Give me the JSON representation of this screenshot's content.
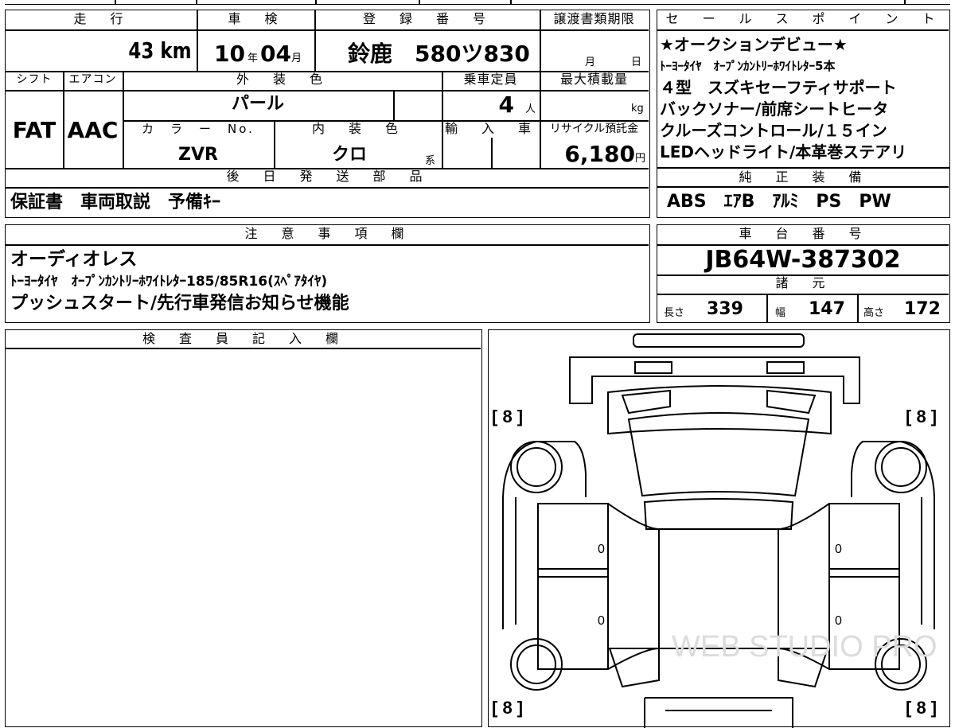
{
  "main": {
    "headers": {
      "mileage": "走　行",
      "inspection": "車　検",
      "reg": "登　録　番　号",
      "deadline": "譲渡書類期限",
      "shift": "シフト",
      "ac": "エアコン",
      "exterior": "外　装　色",
      "seats": "乗車定員",
      "maxload": "最大積載量",
      "colorno": "カ　ラ　ー　No.",
      "interior": "内　装　色",
      "import": "輸　入　車",
      "recycle": "リサイクル預託金"
    },
    "mileage": "43",
    "mileage_unit": "km",
    "inspection": {
      "year": "10",
      "year_unit": "年",
      "month": "04",
      "month_unit": "月"
    },
    "registration": "鈴鹿　580ツ830",
    "deadline": {
      "month_unit": "月",
      "day_unit": "日"
    },
    "shift": "FAT",
    "ac": "AAC",
    "exterior": "パール",
    "seats": "4",
    "seats_unit": "人",
    "maxload_unit": "kg",
    "colorno": "ZVR",
    "interior": "クロ",
    "interior_unit": "系",
    "recycle": "6,180",
    "recycle_unit": "円"
  },
  "sales": {
    "header": "セ　ー　ル　ス　ポ　イ　ン　ト",
    "lines": [
      "★オークションデビュー★",
      "ﾄｰﾖｰﾀｲﾔ　ｵｰﾌﾟﾝｶﾝﾄﾘｰﾎﾜｲﾄﾚﾀｰ5本",
      "４型　スズキセーフティサポート",
      "バックソナー/前席シートヒータ",
      "クルーズコントロール/１５イン",
      "LEDヘッドライト/本革巻ステアリ"
    ]
  },
  "later": {
    "header": "後　日　発　送　部　品",
    "text": "保証書　車両取説　予備ｷｰ"
  },
  "equip": {
    "header": "純　正　装　備",
    "text": "ABS　ｴｱB　ｱﾙﾐ　PS　PW"
  },
  "notes": {
    "header": "注　意　事　項　欄",
    "lines": [
      "オーディオレス",
      "ﾄｰﾖｰﾀｲﾔ　ｵｰﾌﾟﾝｶﾝﾄﾘｰﾎﾜｲﾄﾚﾀｰ185/85R16(ｽﾍﾟｱﾀｲﾔ)",
      "プッシュスタート/先行車発信お知らせ機能"
    ]
  },
  "chassis": {
    "header": "車　台　番　号",
    "number": "JB64W-387302"
  },
  "specs": {
    "header": "諸　元",
    "length_label": "長さ",
    "length": "339",
    "width_label": "幅",
    "width": "147",
    "height_label": "高さ",
    "height": "172"
  },
  "inspector": {
    "header": "検　査　員　記　入　欄"
  },
  "diagram": {
    "tire_fl": "[ 8 ]",
    "tire_fr": "[ 8 ]",
    "tire_rl": "[ 8 ]",
    "tire_rr": "[ 8 ]",
    "door_fl": "0",
    "door_fr": "0",
    "door_rl": "0",
    "door_rr": "0",
    "watermark": "WEB STUDIO PRO"
  }
}
